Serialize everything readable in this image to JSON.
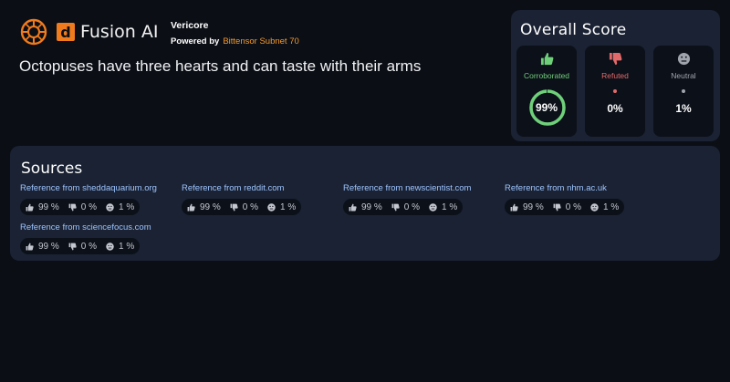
{
  "header": {
    "brand_letter": "d",
    "brand_name": "Fusion AI",
    "vericore": "Vericore",
    "powered_by": "Powered by",
    "powered_link": "Bittensor Subnet 70"
  },
  "claim": "Octopuses have three hearts and can taste with their arms",
  "overall": {
    "title": "Overall Score",
    "corroborated": {
      "label": "Corroborated",
      "value": "99%",
      "fraction": 0.99,
      "color": "#6fd07a"
    },
    "refuted": {
      "label": "Refuted",
      "value": "0%",
      "color": "#e36a6a"
    },
    "neutral": {
      "label": "Neutral",
      "value": "1%",
      "color": "#a0a4ad"
    }
  },
  "sources": {
    "title": "Sources",
    "items": [
      {
        "label": "Reference from sheddaquarium.org",
        "up": "99 %",
        "down": "0 %",
        "neutral": "1 %"
      },
      {
        "label": "Reference from reddit.com",
        "up": "99 %",
        "down": "0 %",
        "neutral": "1 %"
      },
      {
        "label": "Reference from newscientist.com",
        "up": "99 %",
        "down": "0 %",
        "neutral": "1 %"
      },
      {
        "label": "Reference from nhm.ac.uk",
        "up": "99 %",
        "down": "0 %",
        "neutral": "1 %"
      },
      {
        "label": "Reference from sciencefocus.com",
        "up": "99 %",
        "down": "0 %",
        "neutral": "1 %"
      }
    ]
  },
  "colors": {
    "accent": "#f07b1d",
    "link": "#9dc4ff",
    "panel": "#1a2233",
    "background": "#0b0e15"
  }
}
